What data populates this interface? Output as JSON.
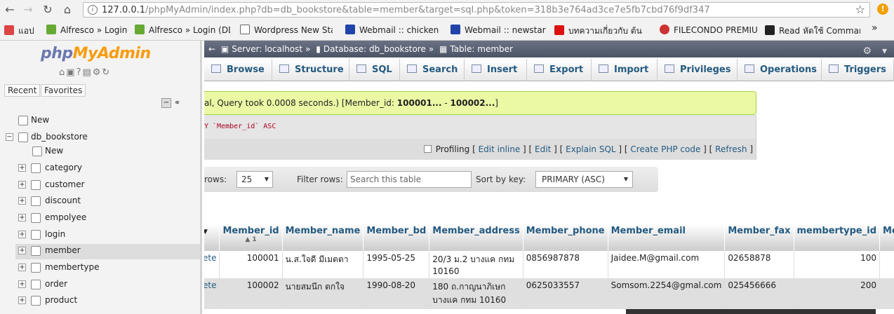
{
  "browser": {
    "url_host": "127.0.0.1",
    "url_path": "/phpMyAdmin/index.php?db=db_bookstore&table=member&target=sql.php&token=318b3e764ad3ce7e5fb7cbd76f9df347",
    "bookmarks": [
      {
        "label": "แอป",
        "color": "#d44"
      },
      {
        "label": "Alfresco » Login",
        "color": "#6a3"
      },
      {
        "label": "Alfresco » Login (DD",
        "color": "#6a3"
      },
      {
        "label": "Wordpress New Star",
        "color": "#fff"
      },
      {
        "label": "Webmail :: chicken-r",
        "color": "#24a"
      },
      {
        "label": "Webmail :: newstarfc",
        "color": "#24a"
      },
      {
        "label": "บทความเกี่ยวกับ ต้น",
        "color": "#d11"
      },
      {
        "label": "FILECONDO PREMIU",
        "color": "#c33"
      },
      {
        "label": "Read หัดใช้ Commanc",
        "color": "#222"
      }
    ],
    "more": "»"
  },
  "sidebar": {
    "logo_php": "php",
    "logo_myadmin": "MyAdmin",
    "tab_recent": "Recent",
    "tab_favorites": "Favorites",
    "new_root": "New",
    "db": "db_bookstore",
    "new_table": "New",
    "tables": [
      "category",
      "customer",
      "discount",
      "empolyee",
      "login",
      "member",
      "membertype",
      "order",
      "product"
    ],
    "selected": "member"
  },
  "breadcrumb": {
    "server": "Server: localhost",
    "database": "Database: db_bookstore",
    "table": "Table: member",
    "sep": "»"
  },
  "tabs": [
    "Browse",
    "Structure",
    "SQL",
    "Search",
    "Insert",
    "Export",
    "Import",
    "Privileges",
    "Operations",
    "Triggers"
  ],
  "message": {
    "text": "al, Query took 0.0008 seconds.) [Member_id: ",
    "range_a": "100001...",
    "dash": " - ",
    "range_b": "100002...",
    "end": "]"
  },
  "sql": {
    "prefix": "Y `Member_id` ASC"
  },
  "links": {
    "profiling": "Profiling",
    "edit_inline": "Edit inline",
    "edit": "Edit",
    "explain": "Explain SQL",
    "php": "Create PHP code",
    "refresh": "Refresh"
  },
  "nav": {
    "rows_label": "rows:",
    "rows_value": "25",
    "filter_label": "Filter rows:",
    "filter_placeholder": "Search this table",
    "sort_label": "Sort by key:",
    "sort_value": "PRIMARY (ASC)"
  },
  "table": {
    "columns": [
      "Member_id",
      "Member_name",
      "Member_bd",
      "Member_address",
      "Member_phone",
      "Member_email",
      "Member_fax",
      "membertype_id",
      "Me"
    ],
    "sort_indicator": "▲ 1",
    "rows": [
      {
        "action": "ete",
        "id": "100001",
        "name": "น.ส.ใจดี มีเมตตา",
        "bd": "1995-05-25",
        "address": "20/3 ม.2 บางแค กทม 10160",
        "phone": "0856987878",
        "email": "Jaidee.M@gmail.com",
        "fax": "02658878",
        "type": "100"
      },
      {
        "action": "ete",
        "id": "100002",
        "name": "นายสมนึก ตกใจ",
        "bd": "1990-08-20",
        "address": "180 ถ.กาญนาภิเษก บางแค กทม 10160",
        "phone": "0625033557",
        "email": "Somsom.2254@gmal.com",
        "fax": "025456666",
        "type": "200"
      }
    ]
  }
}
